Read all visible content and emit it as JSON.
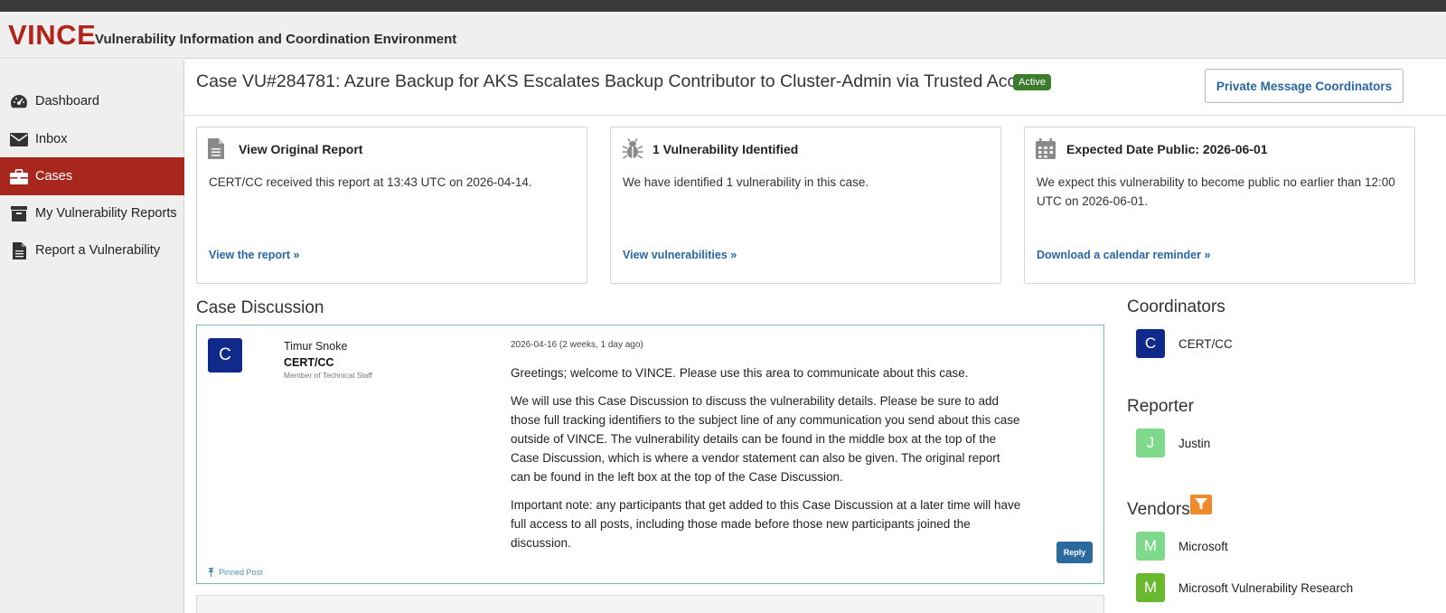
{
  "app": {
    "logo": "VINCE",
    "tagline": "Vulnerability Information and Coordination Environment"
  },
  "sidebar": {
    "items": [
      {
        "label": "Dashboard",
        "icon": "dashboard-gauge-icon",
        "active": false
      },
      {
        "label": "Inbox",
        "icon": "envelope-icon",
        "active": false
      },
      {
        "label": "Cases",
        "icon": "briefcase-icon",
        "active": true
      },
      {
        "label": "My Vulnerability Reports",
        "icon": "archive-box-icon",
        "active": false
      },
      {
        "label": "Report a Vulnerability",
        "icon": "document-icon",
        "active": false
      }
    ]
  },
  "case": {
    "title": "Case VU#284781: Azure Backup for AKS Escalates Backup Contributor to Cluster-Admin via Trusted Access",
    "status": "Active",
    "pm_button": "Private Message Coordinators"
  },
  "infoboxes": [
    {
      "icon": "document-icon",
      "title": "View Original Report",
      "body": "CERT/CC received this report at 13:43 UTC on 2026-04-14.",
      "link": "View the report »"
    },
    {
      "icon": "bug-icon",
      "title": "1 Vulnerability Identified",
      "body": "We have identified 1 vulnerability in this case.",
      "link": "View vulnerabilities »"
    },
    {
      "icon": "calendar-icon",
      "title": "Expected Date Public: 2026-06-01",
      "body": "We expect this vulnerability to become public no earlier than 12:00 UTC on 2026-06-01.",
      "link": "Download a calendar reminder »"
    }
  ],
  "discussion": {
    "title": "Case Discussion",
    "post": {
      "avatar_letter": "C",
      "author": "Timur Snoke",
      "org": "CERT/CC",
      "role": "Member of Technical Staff",
      "timestamp": "2026-04-16 (2 weeks, 1 day ago)",
      "paragraphs": [
        "Greetings; welcome to VINCE. Please use this area to communicate about this case.",
        "We will use this Case Discussion to discuss the vulnerability details. Please be sure to add those full tracking identifiers to the subject line of any communication you send about this case outside of VINCE. The vulnerability details can be found in the middle box at the top of the Case Discussion, which is where a vendor statement can also be given. The original report can be found in the left box at the top of the Case Discussion.",
        "Important note: any participants that get added to this Case Discussion at a later time will have full access to all posts, including those made before those new participants joined the discussion."
      ],
      "pinned": "Pinned Post",
      "reply": "Reply"
    }
  },
  "rightpanel": {
    "coordinators_title": "Coordinators",
    "coordinators": [
      {
        "letter": "C",
        "name": "CERT/CC",
        "color": "#0f2a8a"
      }
    ],
    "reporter_title": "Reporter",
    "reporters": [
      {
        "letter": "J",
        "name": "Justin",
        "color": "#7fd98c"
      }
    ],
    "vendors_title": "Vendors",
    "vendors": [
      {
        "letter": "M",
        "name": "Microsoft",
        "color": "#7fd98c"
      },
      {
        "letter": "M",
        "name": "Microsoft Vulnerability Research",
        "color": "#6ab82e"
      }
    ]
  },
  "colors": {
    "brand_red": "#b0241a",
    "active_nav": "#a8271d",
    "link_blue": "#2a66a6",
    "status_green": "#3d7b2d",
    "filter_orange": "#ef8a2a"
  }
}
